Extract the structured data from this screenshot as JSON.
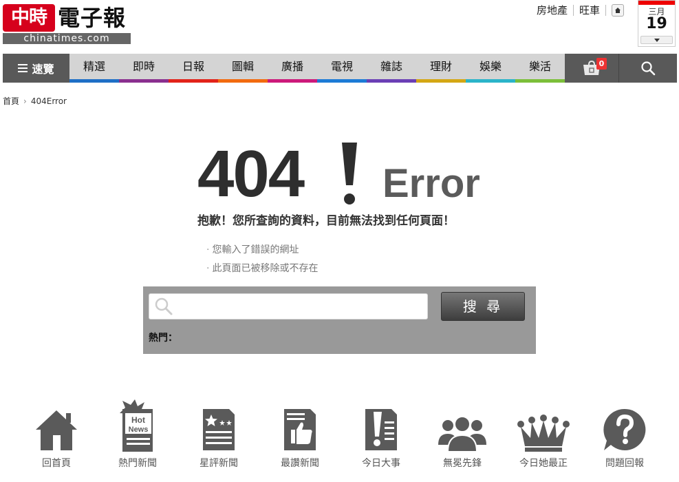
{
  "logo": {
    "badge": "中時",
    "title": "電子報",
    "sub": "chinatimes.com"
  },
  "toplinks": [
    "房地產",
    "旺車"
  ],
  "calendar": {
    "month": "三月",
    "day": "19"
  },
  "nav": {
    "browse_label": "速覽",
    "items": [
      {
        "label": "精選",
        "color": "#1e6fc6"
      },
      {
        "label": "即時",
        "color": "#8a2f8f"
      },
      {
        "label": "日報",
        "color": "#e2231a"
      },
      {
        "label": "圖輯",
        "color": "#f26b0f"
      },
      {
        "label": "廣播",
        "color": "#cc1a7a"
      },
      {
        "label": "電視",
        "color": "#1c7bd6"
      },
      {
        "label": "雜誌",
        "color": "#6b3fb5"
      },
      {
        "label": "理財",
        "color": "#d4a714"
      },
      {
        "label": "娛樂",
        "color": "#2bb4c9"
      },
      {
        "label": "樂活",
        "color": "#7cbf3a"
      }
    ],
    "cart_count": "0"
  },
  "breadcrumb": {
    "home": "首頁",
    "current": "404Error"
  },
  "error": {
    "code": "404",
    "word": "Error",
    "message": "抱歉！您所查詢的資料，目前無法找到任何頁面！",
    "reasons": [
      "您輸入了錯誤的網址",
      "此頁面已被移除或不存在"
    ]
  },
  "search": {
    "placeholder": "",
    "button_label": "搜 尋",
    "hot_label": "熱門："
  },
  "quick_links": [
    {
      "label": "回首頁",
      "icon": "home-icon"
    },
    {
      "label": "熱門新聞",
      "icon": "hot-news-icon"
    },
    {
      "label": "星評新聞",
      "icon": "star-news-icon"
    },
    {
      "label": "最讚新聞",
      "icon": "thumbs-up-icon"
    },
    {
      "label": "今日大事",
      "icon": "exclamation-icon"
    },
    {
      "label": "無冕先鋒",
      "icon": "people-icon"
    },
    {
      "label": "今日她最正",
      "icon": "crown-icon"
    },
    {
      "label": "問題回報",
      "icon": "question-icon"
    }
  ]
}
